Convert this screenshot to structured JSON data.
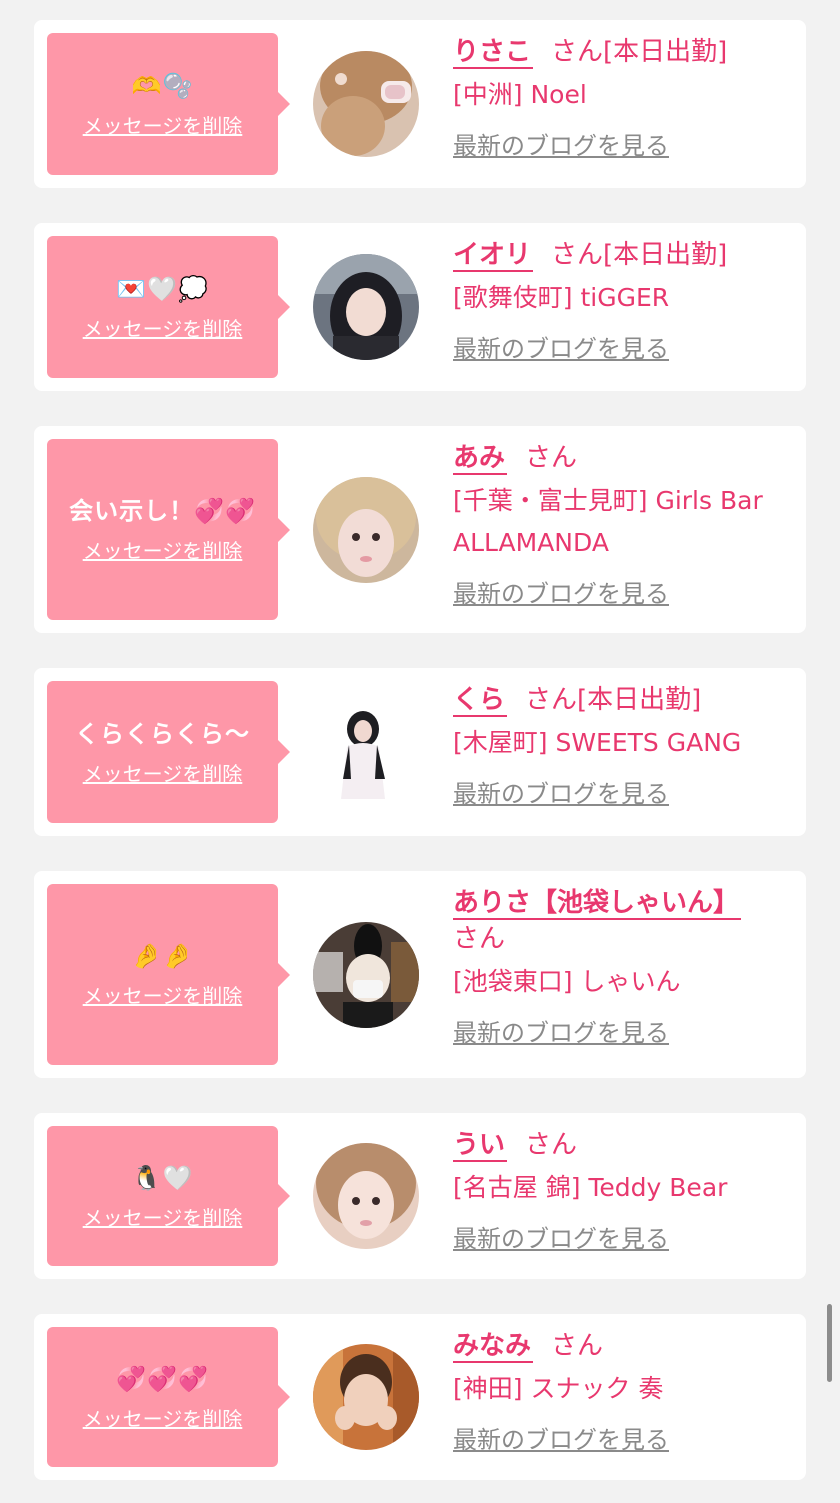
{
  "colors": {
    "accent": "#e8386e",
    "bubble": "#fe97a8",
    "link_gray": "#8a8a8a",
    "background": "#f2f2f2"
  },
  "delete_label": "メッセージを削除",
  "blog_label": "最新のブログを見る",
  "san_label": "さん",
  "entries": [
    {
      "message": "🫶🫧",
      "name": "りさこ",
      "status": "[本日出勤]",
      "shop": "[中洲] Noel"
    },
    {
      "message": "💌🤍💭",
      "name": "イオリ",
      "status": "[本日出勤]",
      "shop": "[歌舞伎町] tiGGER"
    },
    {
      "message": "会い示し！💞💞",
      "name": "あみ",
      "status": "",
      "shop": "[千葉・富士見町] Girls Bar ALLAMANDA"
    },
    {
      "message": "くらくらくら〜",
      "name": "くら",
      "status": "[本日出勤]",
      "shop": "[木屋町] SWEETS GANG"
    },
    {
      "message": "🤌🤌",
      "name": "ありさ【池袋しゃいん】",
      "status": "",
      "shop": "[池袋東口] しゃいん"
    },
    {
      "message": "🐧🤍",
      "name": "うい",
      "status": "",
      "shop": "[名古屋 錦] Teddy Bear"
    },
    {
      "message": "💞💞💞",
      "name": "みなみ",
      "status": "",
      "shop": "[神田] スナック 奏"
    }
  ]
}
